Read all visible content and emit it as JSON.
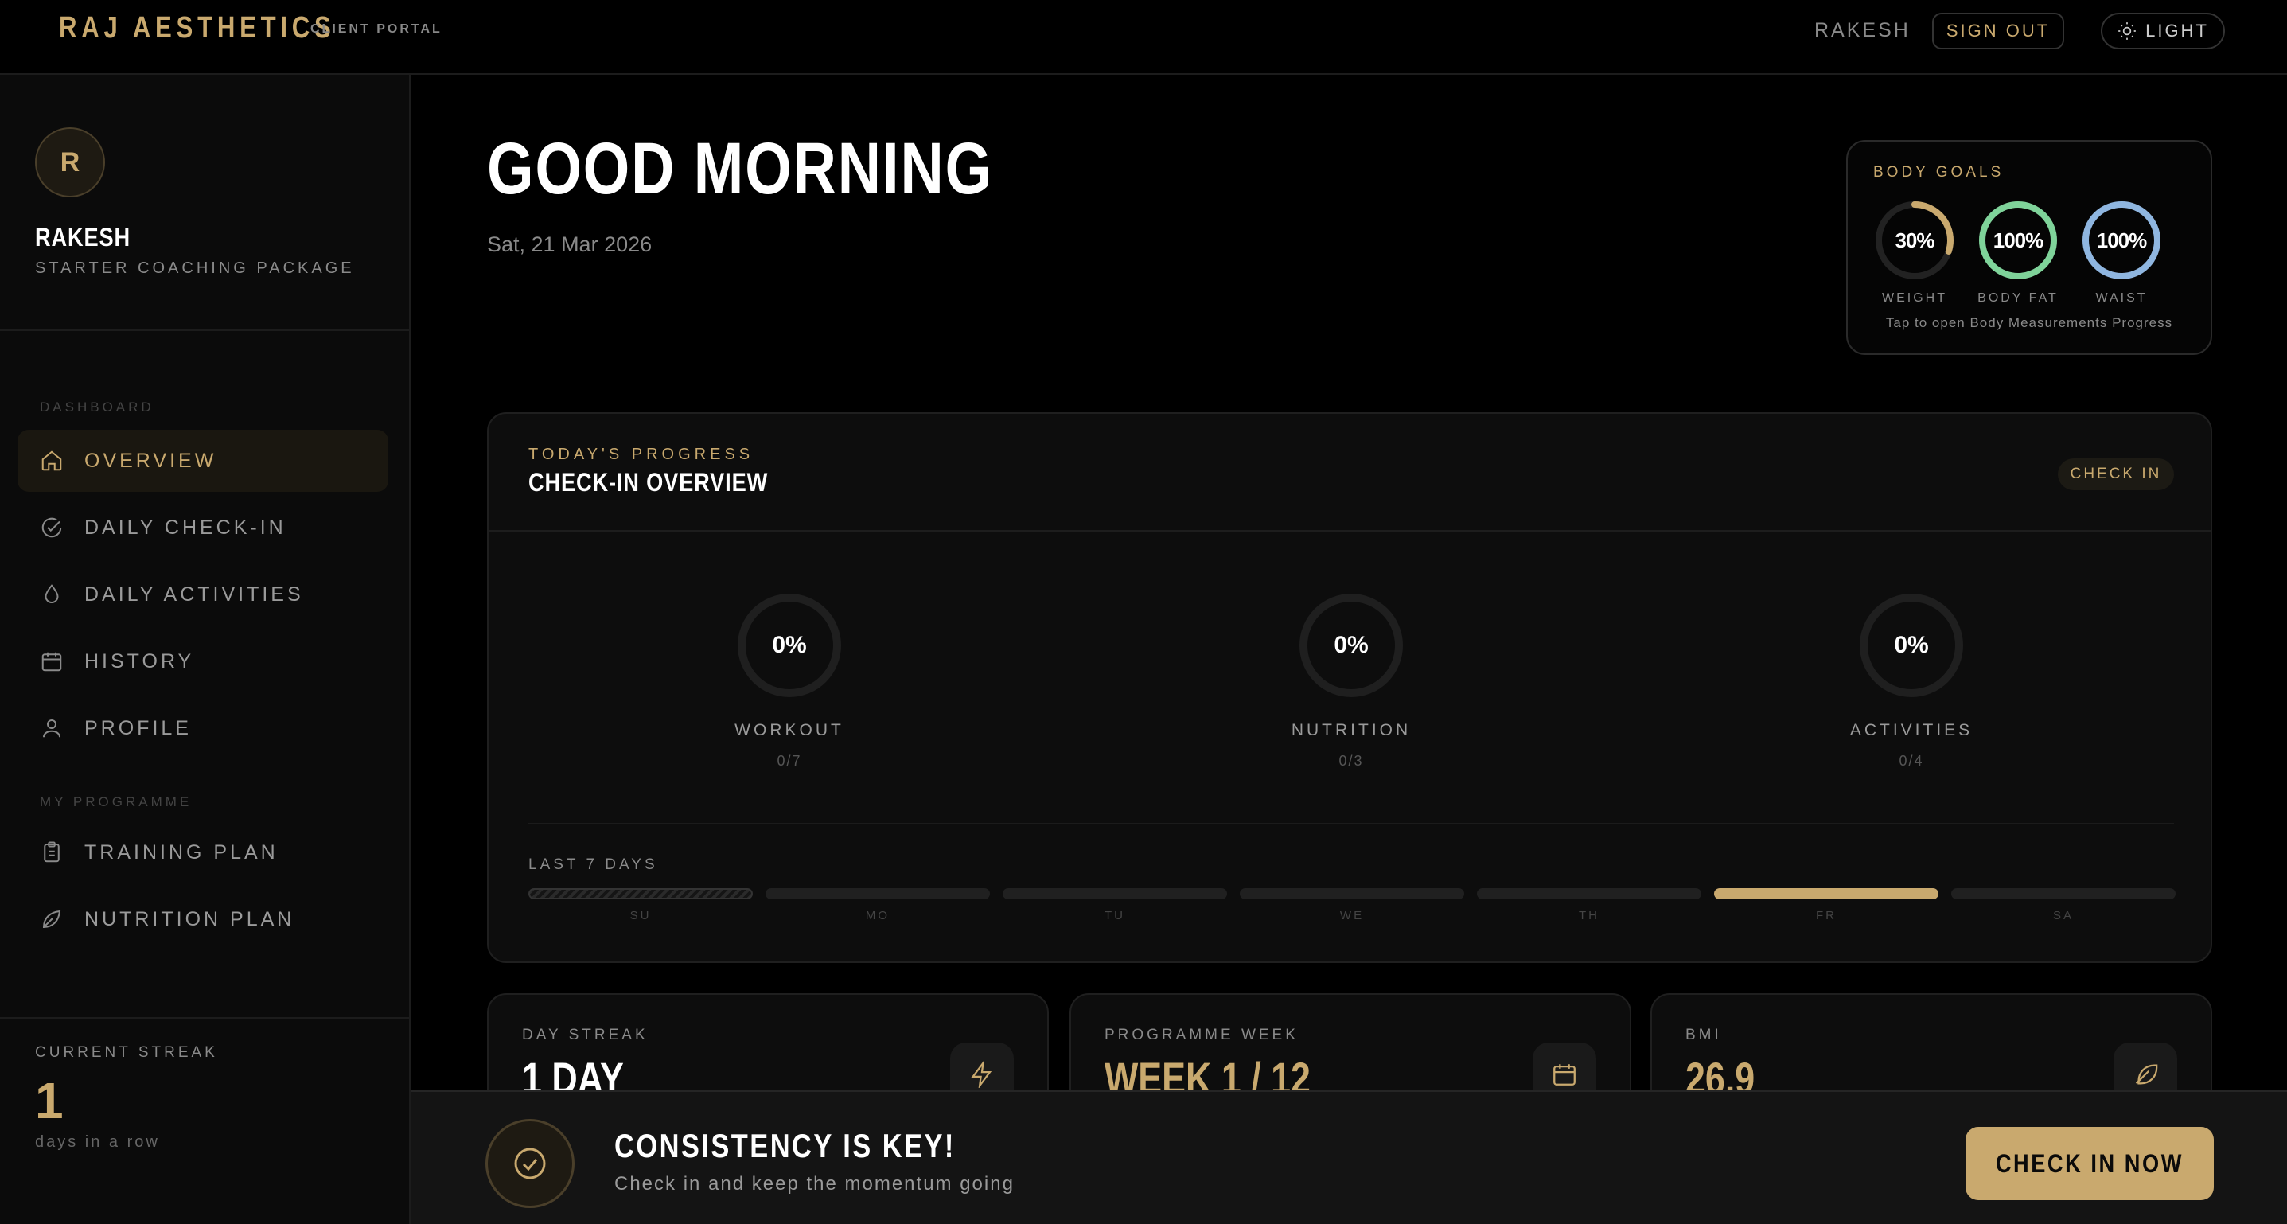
{
  "topbar": {
    "brand": "RAJ AESTHETICS",
    "brand_sub": "CLIENT PORTAL",
    "user": "RAKESH",
    "signout_label": "SIGN OUT",
    "theme_label": "LIGHT"
  },
  "sidebar": {
    "avatar_initial": "R",
    "user_name": "RAKESH",
    "package": "STARTER COACHING PACKAGE",
    "sections": [
      {
        "label": "DASHBOARD",
        "items": [
          {
            "label": "OVERVIEW",
            "icon": "home-icon",
            "active": true
          },
          {
            "label": "DAILY CHECK-IN",
            "icon": "check-circle-icon"
          },
          {
            "label": "DAILY ACTIVITIES",
            "icon": "droplet-icon"
          },
          {
            "label": "HISTORY",
            "icon": "calendar-icon"
          },
          {
            "label": "PROFILE",
            "icon": "user-icon"
          }
        ]
      },
      {
        "label": "MY PROGRAMME",
        "items": [
          {
            "label": "TRAINING PLAN",
            "icon": "clipboard-icon"
          },
          {
            "label": "NUTRITION PLAN",
            "icon": "leaf-icon"
          }
        ]
      }
    ],
    "streak": {
      "label": "CURRENT STREAK",
      "value": "1",
      "sub": "days in a row"
    }
  },
  "main": {
    "greeting": "GOOD MORNING",
    "date": "Sat, 21 Mar 2026"
  },
  "body_goals": {
    "title": "BODY GOALS",
    "goals": [
      {
        "label": "WEIGHT",
        "display": "30%",
        "value": 0.3,
        "color": "#c9a96e"
      },
      {
        "label": "BODY FAT",
        "display": "100%",
        "value": 1.0,
        "color": "#7fd39a"
      },
      {
        "label": "WAIST",
        "display": "100%",
        "value": 1.0,
        "color": "#8fb6e0"
      }
    ],
    "note": "Tap to open Body Measurements Progress"
  },
  "progress": {
    "kicker": "TODAY'S PROGRESS",
    "title": "CHECK-IN OVERVIEW",
    "checkin_label": "CHECK IN",
    "metrics": [
      {
        "label": "WORKOUT",
        "display": "0%",
        "count": "0/7"
      },
      {
        "label": "NUTRITION",
        "display": "0%",
        "count": "0/3"
      },
      {
        "label": "ACTIVITIES",
        "display": "0%",
        "count": "0/4"
      }
    ],
    "last7_label": "LAST 7 DAYS",
    "days": [
      {
        "label": "SU",
        "state": "today"
      },
      {
        "label": "MO",
        "state": "none"
      },
      {
        "label": "TU",
        "state": "none"
      },
      {
        "label": "WE",
        "state": "none"
      },
      {
        "label": "TH",
        "state": "none"
      },
      {
        "label": "FR",
        "state": "done"
      },
      {
        "label": "SA",
        "state": "none"
      }
    ]
  },
  "stats": [
    {
      "label": "DAY STREAK",
      "value": "1 DAY",
      "icon": "lightning-icon",
      "color": "#ffffff"
    },
    {
      "label": "PROGRAMME WEEK",
      "value": "WEEK 1 / 12",
      "icon": "calendar-icon",
      "color": "#c9a96e"
    },
    {
      "label": "BMI",
      "value": "26.9",
      "icon": "feather-icon",
      "color": "#c9a96e"
    }
  ],
  "banner": {
    "title": "CONSISTENCY IS KEY!",
    "sub": "Check in and keep the momentum going",
    "button": "CHECK IN NOW"
  }
}
